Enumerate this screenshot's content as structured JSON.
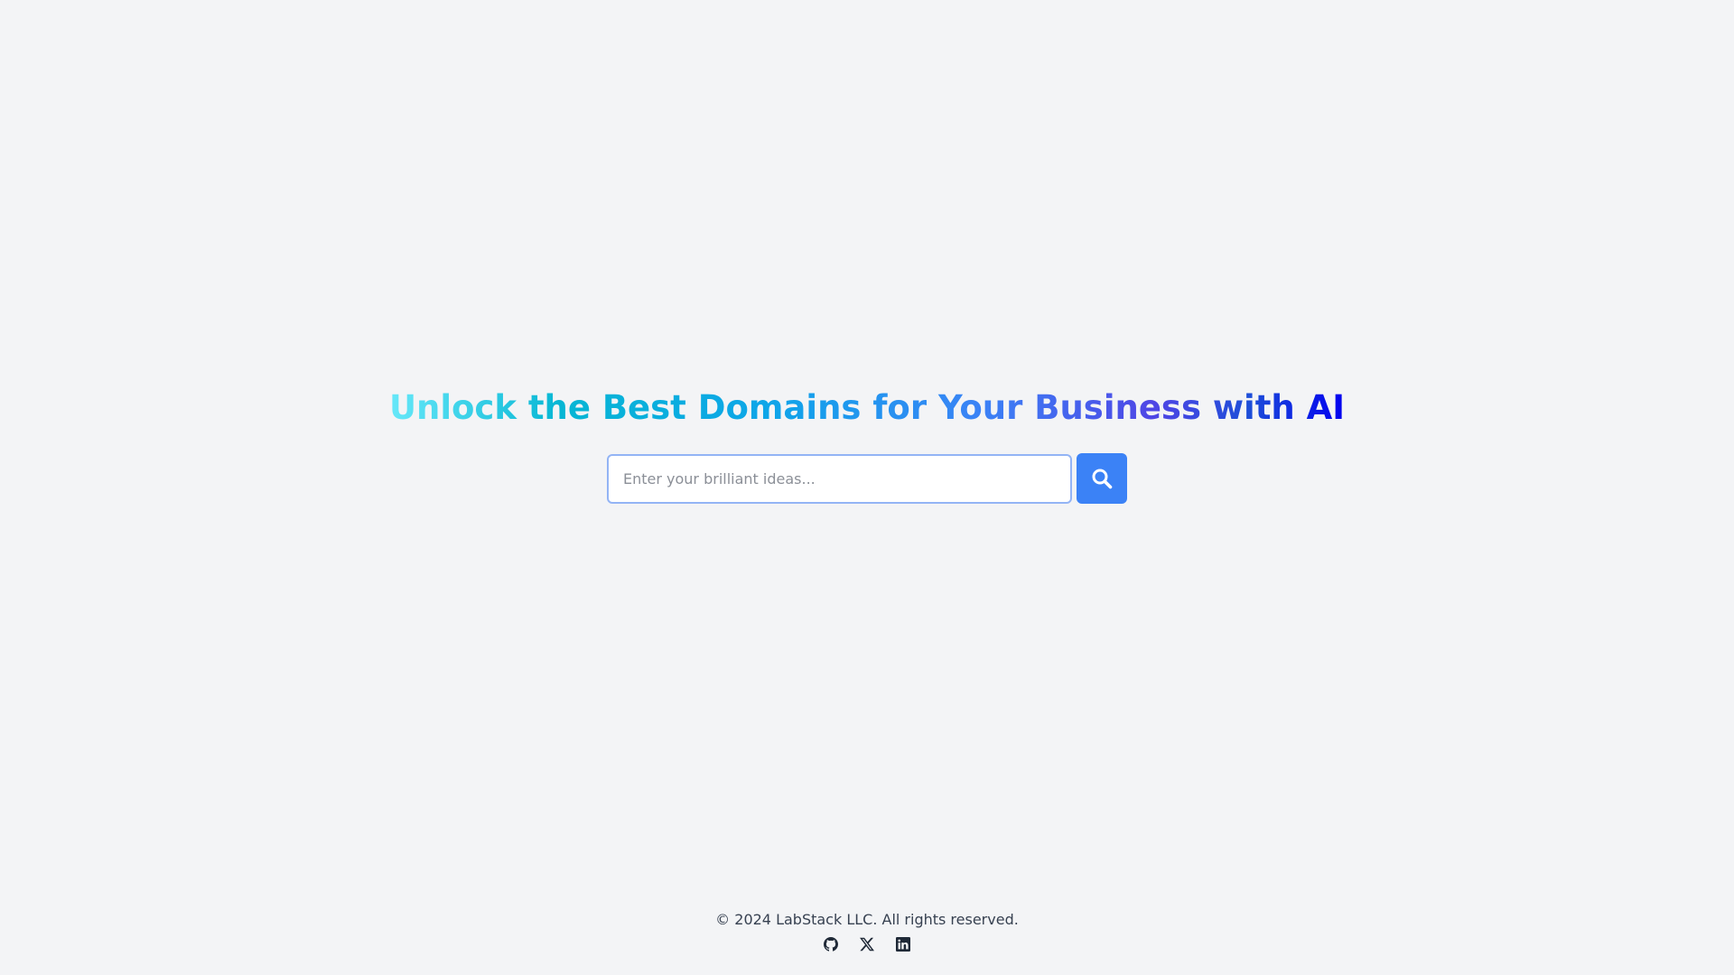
{
  "hero": {
    "headline": "Unlock the Best Domains for Your Business with AI",
    "gradient_colors": [
      "#67e8f9",
      "#06b6d4",
      "#0ea5e9",
      "#3b82f6",
      "#4f46e5",
      "#0000f0"
    ]
  },
  "search": {
    "placeholder": "Enter your brilliant ideas...",
    "value": "",
    "button_icon": "search-icon",
    "button_color": "#3b82f6"
  },
  "footer": {
    "copyright": "© 2024 LabStack LLC. All rights reserved.",
    "social_links": [
      {
        "icon": "github-icon"
      },
      {
        "icon": "x-icon"
      },
      {
        "icon": "linkedin-icon"
      }
    ]
  }
}
